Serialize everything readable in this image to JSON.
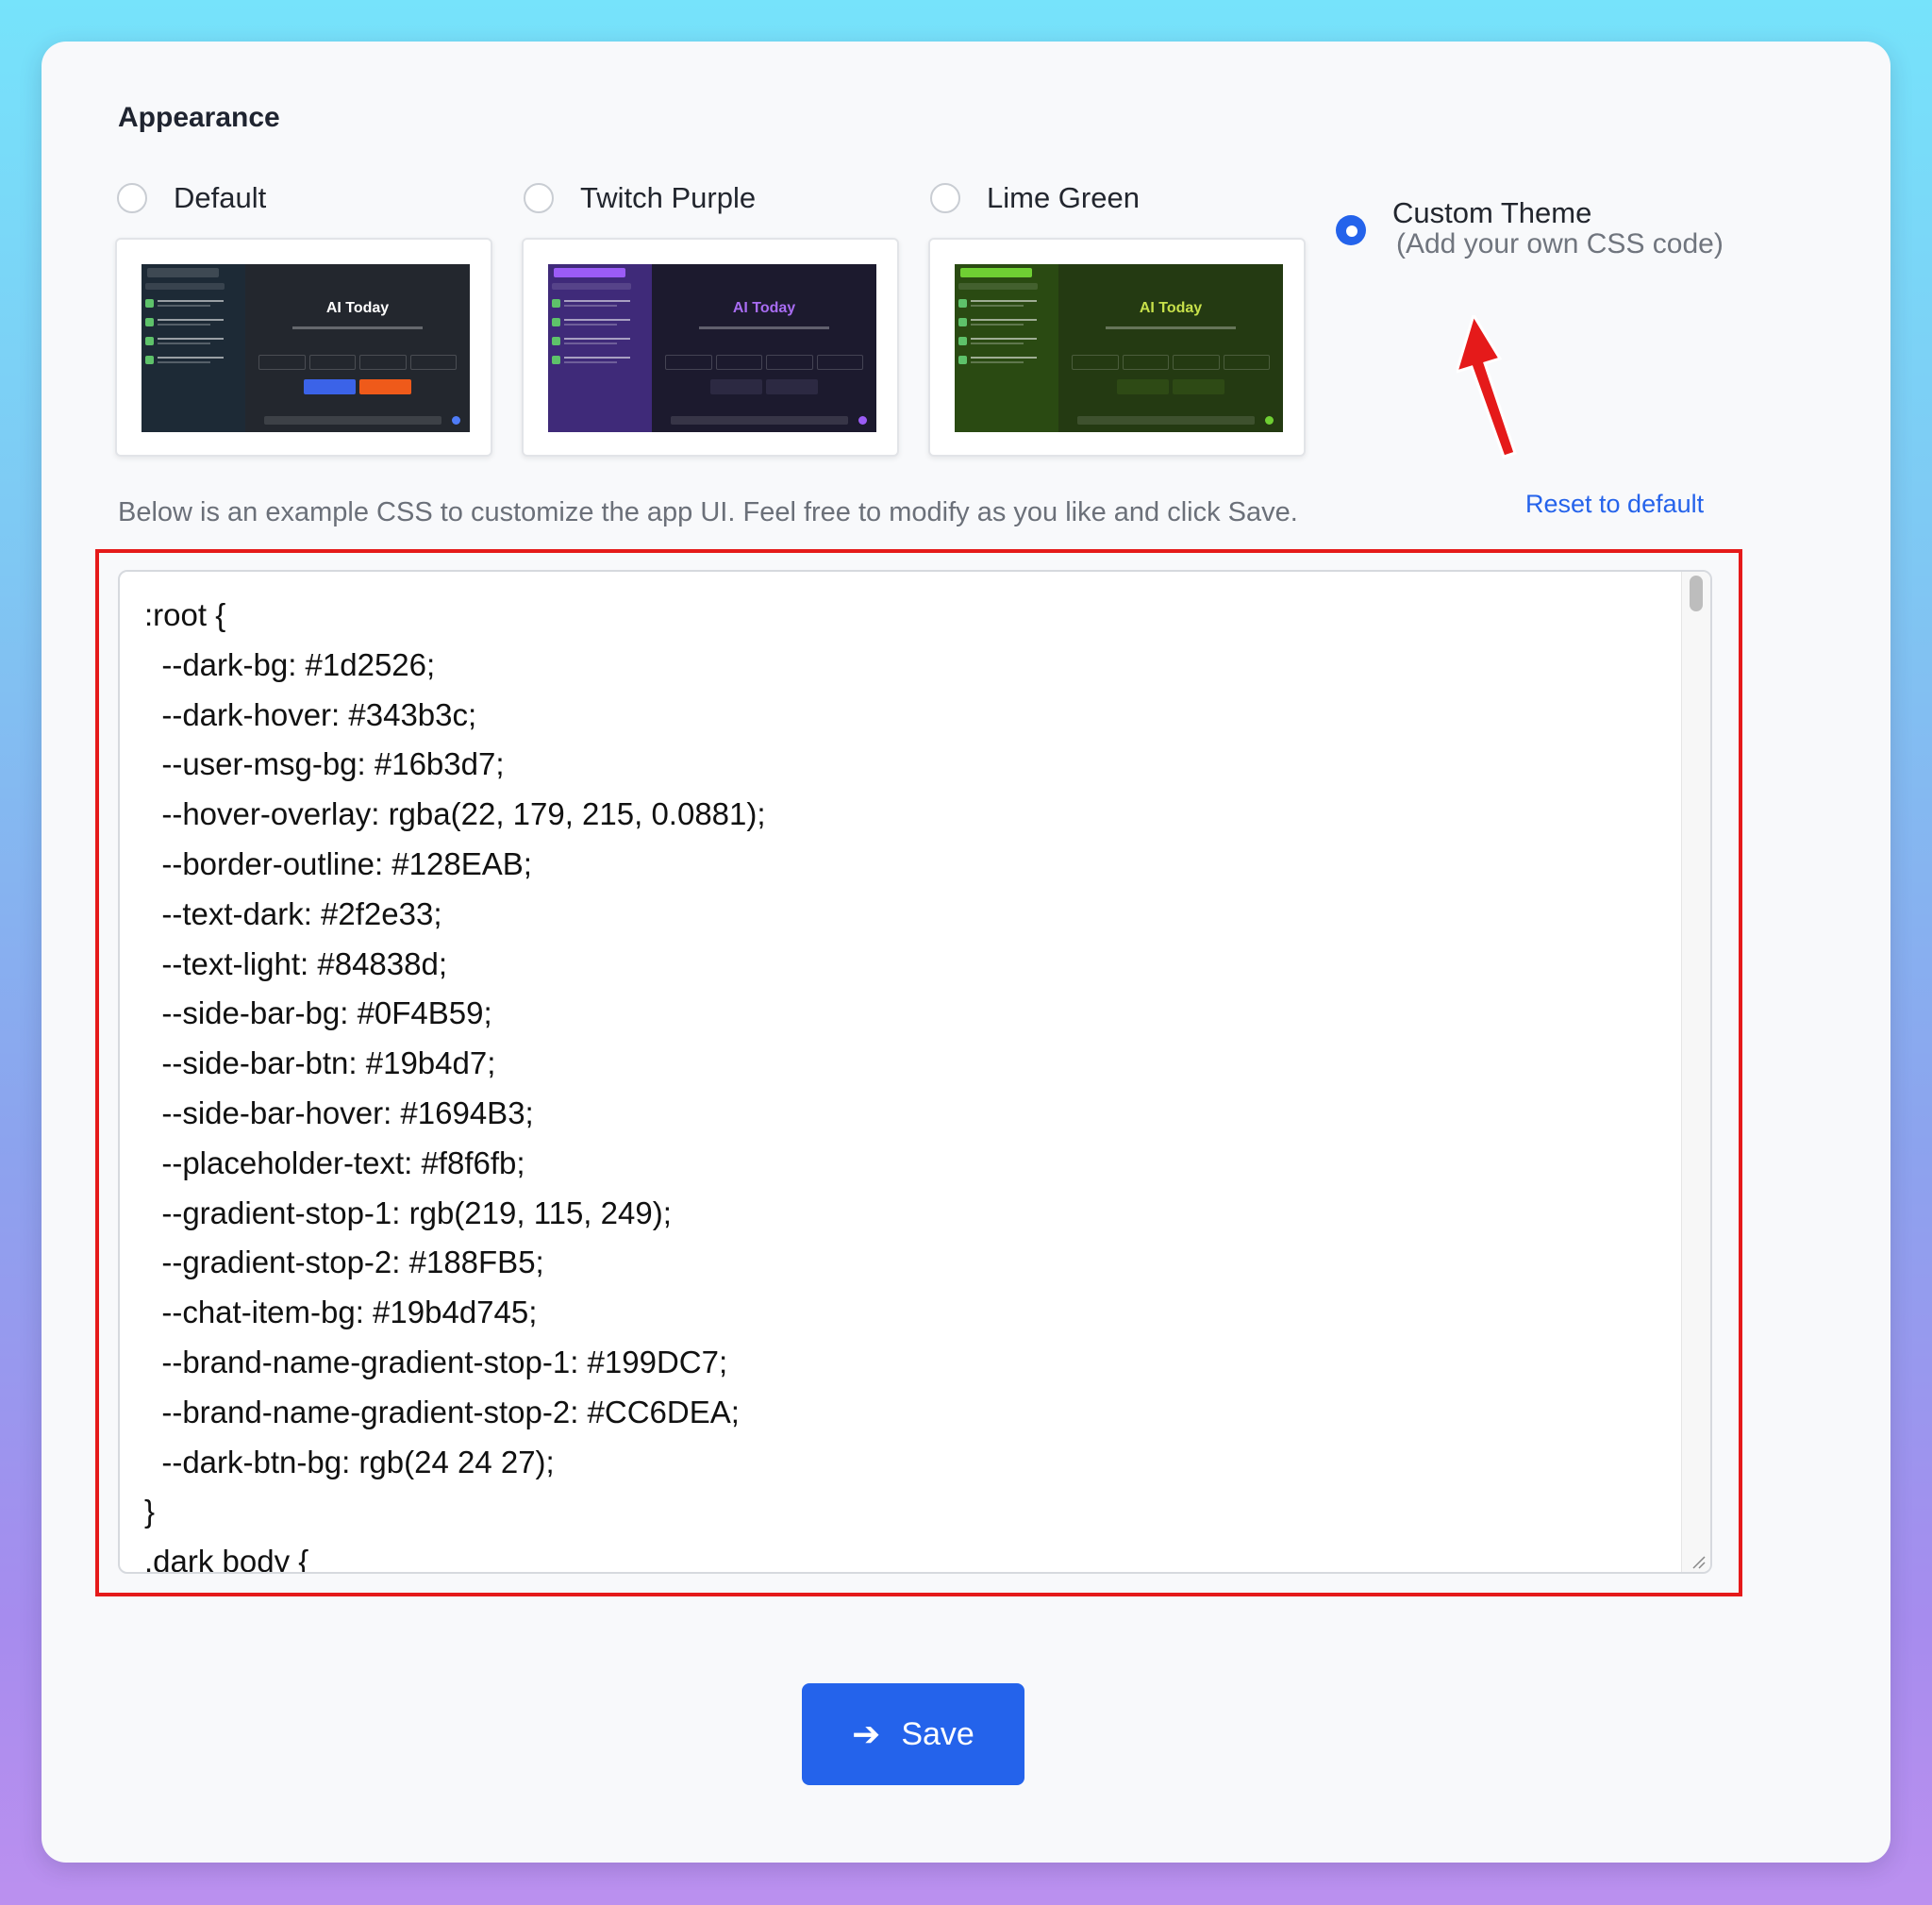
{
  "section": {
    "title": "Appearance"
  },
  "themes": [
    {
      "label": "Default",
      "selected": false,
      "accent": "#4f7cf7",
      "side_bg": "#1d2a36",
      "main_bg": "#23272e",
      "brand_color": "#ffffff",
      "btn1": "#3b63e8",
      "btn2": "#ef5a1a"
    },
    {
      "label": "Twitch Purple",
      "selected": false,
      "accent": "#9b5cf6",
      "side_bg": "#3f2a79",
      "main_bg": "#1c1a2e",
      "brand_color": "#a86cf2",
      "btn1": "#2c2942",
      "btn2": "#2c2942"
    },
    {
      "label": "Lime Green",
      "selected": false,
      "accent": "#6fcf33",
      "side_bg": "#2a4a12",
      "main_bg": "#243a12",
      "brand_color": "#c7e04a",
      "btn1": "#2e4a15",
      "btn2": "#2e4a15"
    },
    {
      "label": "Custom Theme",
      "selected": true,
      "sublabel": "(Add your own CSS code)"
    }
  ],
  "theme_preview": {
    "brand": "AI Today"
  },
  "description": "Below is an example CSS to customize the app UI. Feel free to modify as you like and click Save.",
  "reset_link": "Reset to default",
  "css_code": ":root {\n  --dark-bg: #1d2526;\n  --dark-hover: #343b3c;\n  --user-msg-bg: #16b3d7;\n  --hover-overlay: rgba(22, 179, 215, 0.0881);\n  --border-outline: #128EAB;\n  --text-dark: #2f2e33;\n  --text-light: #84838d;\n  --side-bar-bg: #0F4B59;\n  --side-bar-btn: #19b4d7;\n  --side-bar-hover: #1694B3;\n  --placeholder-text: #f8f6fb;\n  --gradient-stop-1: rgb(219, 115, 249);\n  --gradient-stop-2: #188FB5;\n  --chat-item-bg: #19b4d745;\n  --brand-name-gradient-stop-1: #199DC7;\n  --brand-name-gradient-stop-2: #CC6DEA;\n  --dark-btn-bg: rgb(24 24 27);\n}\n.dark body {",
  "save_button": {
    "label": "Save",
    "icon": "arrow-right-icon"
  },
  "colors": {
    "primary": "#2463eb",
    "highlight": "#e51a1a",
    "annotation_arrow": "#e51a1a"
  }
}
